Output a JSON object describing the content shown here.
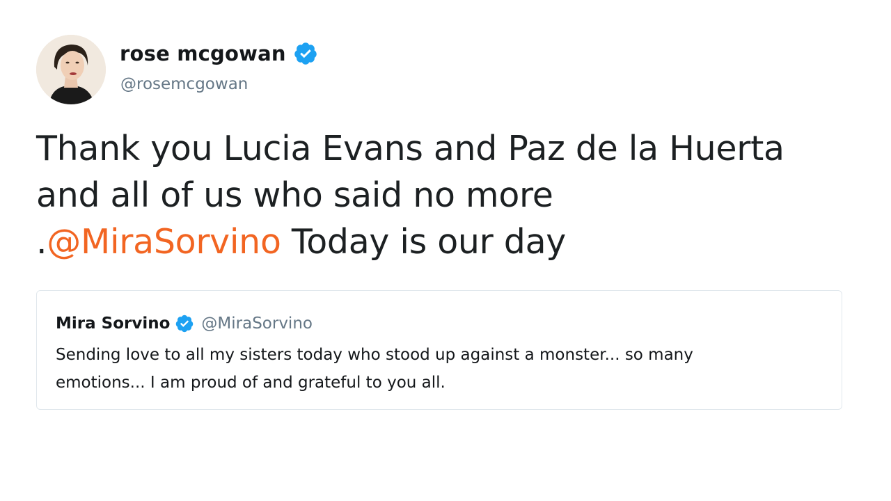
{
  "author": {
    "display_name": "rose mcgowan",
    "handle": "@rosemcgowan",
    "verified": true,
    "avatar_icon": "profile-photo"
  },
  "tweet": {
    "line1": "Thank you Lucia Evans and Paz de la Huerta",
    "line2": "and all of us who said no more",
    "line3_prefix": ".",
    "line3_mention": "@MiraSorvino",
    "line3_suffix": " Today is our day"
  },
  "quoted_tweet": {
    "display_name": "Mira Sorvino",
    "handle": "@MiraSorvino",
    "verified": true,
    "line1": "Sending love to all my sisters today who stood up against a monster... so many",
    "line2": "emotions... I am proud of and grateful to you all."
  },
  "colors": {
    "verified_badge": "#1da1f2",
    "mention": "#f26522",
    "secondary_text": "#657786",
    "card_border": "#e1e8ed"
  }
}
